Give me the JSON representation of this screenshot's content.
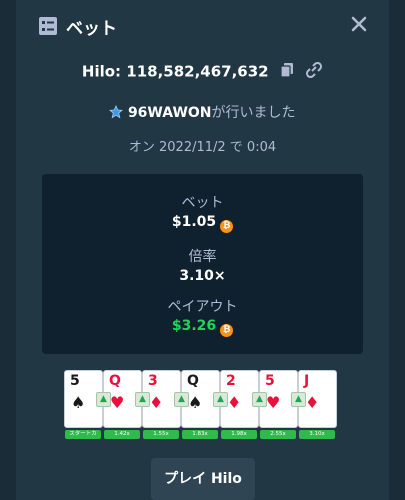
{
  "header": {
    "title": "ベット",
    "icon": "bet-list-icon",
    "close_icon": "close-icon"
  },
  "bet": {
    "game_label": "Hilo: 118,582,467,632",
    "player_name": "96WAWON",
    "player_suffix": "が行いました",
    "date_line": "オン 2022/11/2 で 0:04"
  },
  "stats": {
    "bet_label": "ベット",
    "bet_value": "$1.05",
    "multiplier_label": "倍率",
    "multiplier_value": "3.10×",
    "payout_label": "ペイアウト",
    "payout_value": "$3.26"
  },
  "cards": [
    {
      "rank": "5",
      "suit": "♠",
      "color": "black",
      "pill": "スタートカ"
    },
    {
      "rank": "Q",
      "suit": "♥",
      "color": "red",
      "pill": "1.42x"
    },
    {
      "rank": "3",
      "suit": "♦",
      "color": "red",
      "pill": "1.55x"
    },
    {
      "rank": "Q",
      "suit": "♠",
      "color": "black",
      "pill": "1.83x"
    },
    {
      "rank": "2",
      "suit": "♦",
      "color": "red",
      "pill": "1.98x"
    },
    {
      "rank": "5",
      "suit": "♥",
      "color": "red",
      "pill": "2.55x"
    },
    {
      "rank": "J",
      "suit": "♦",
      "color": "red",
      "pill": "3.10x"
    }
  ],
  "actions": {
    "play_label": "プレイ Hilo"
  },
  "colors": {
    "accent_green": "#22d35a",
    "coin": "#f7931a",
    "panel": "#213743"
  }
}
